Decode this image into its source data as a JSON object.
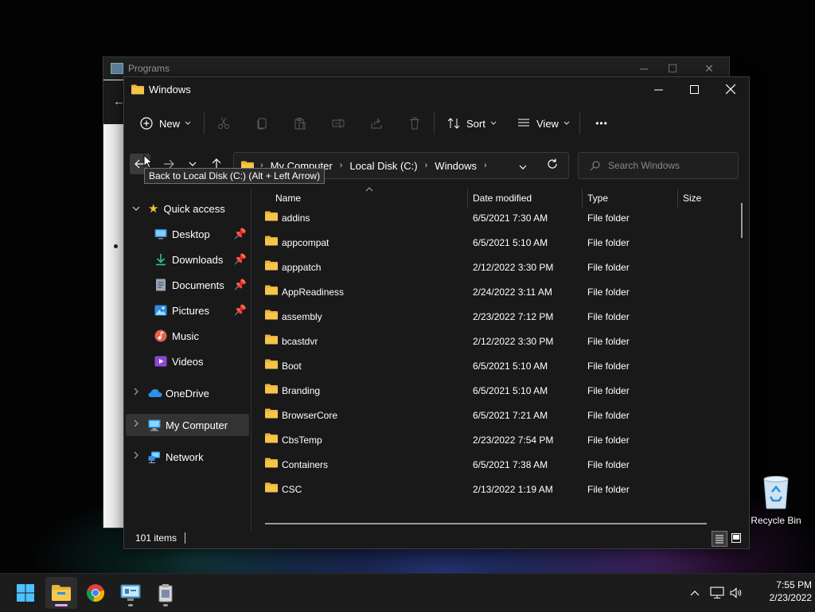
{
  "background_window": {
    "title": "Programs",
    "back_arrow": "←"
  },
  "window": {
    "title": "Windows",
    "controls": {
      "minimize": "─",
      "maximize": "☐",
      "close": "✕"
    }
  },
  "toolbar": {
    "new_label": "New",
    "sort_label": "Sort",
    "view_label": "View",
    "more_label": "•••"
  },
  "navigation": {
    "back_tooltip": "Back to Local Disk (C:) (Alt + Left Arrow)",
    "breadcrumb": [
      "My Computer",
      "Local Disk (C:)",
      "Windows"
    ],
    "search_placeholder": "Search Windows"
  },
  "sidebar": {
    "quick_access": "Quick access",
    "items": [
      {
        "label": "Desktop",
        "icon": "desktop-icon",
        "pinned": true
      },
      {
        "label": "Downloads",
        "icon": "downloads-icon",
        "pinned": true
      },
      {
        "label": "Documents",
        "icon": "documents-icon",
        "pinned": true
      },
      {
        "label": "Pictures",
        "icon": "pictures-icon",
        "pinned": true
      },
      {
        "label": "Music",
        "icon": "music-icon",
        "pinned": false
      },
      {
        "label": "Videos",
        "icon": "videos-icon",
        "pinned": false
      }
    ],
    "onedrive": "OneDrive",
    "my_computer": "My Computer",
    "network": "Network"
  },
  "columns": {
    "name": "Name",
    "date_modified": "Date modified",
    "type": "Type",
    "size": "Size"
  },
  "files": [
    {
      "name": "addins",
      "date": "6/5/2021 7:30 AM",
      "type": "File folder"
    },
    {
      "name": "appcompat",
      "date": "6/5/2021 5:10 AM",
      "type": "File folder"
    },
    {
      "name": "apppatch",
      "date": "2/12/2022 3:30 PM",
      "type": "File folder"
    },
    {
      "name": "AppReadiness",
      "date": "2/24/2022 3:11 AM",
      "type": "File folder"
    },
    {
      "name": "assembly",
      "date": "2/23/2022 7:12 PM",
      "type": "File folder"
    },
    {
      "name": "bcastdvr",
      "date": "2/12/2022 3:30 PM",
      "type": "File folder"
    },
    {
      "name": "Boot",
      "date": "6/5/2021 5:10 AM",
      "type": "File folder"
    },
    {
      "name": "Branding",
      "date": "6/5/2021 5:10 AM",
      "type": "File folder"
    },
    {
      "name": "BrowserCore",
      "date": "6/5/2021 7:21 AM",
      "type": "File folder"
    },
    {
      "name": "CbsTemp",
      "date": "2/23/2022 7:54 PM",
      "type": "File folder"
    },
    {
      "name": "Containers",
      "date": "6/5/2021 7:38 AM",
      "type": "File folder"
    },
    {
      "name": "CSC",
      "date": "2/13/2022 1:19 AM",
      "type": "File folder"
    }
  ],
  "status": {
    "item_count": "101 items"
  },
  "desktop": {
    "recycle_bin": "Recycle Bin"
  },
  "taskbar": {
    "time": "7:55 PM",
    "date": "2/23/2022"
  },
  "colors": {
    "folder": "#e8b43a",
    "accent": "#4cc2ff",
    "window_bg": "#191919"
  }
}
